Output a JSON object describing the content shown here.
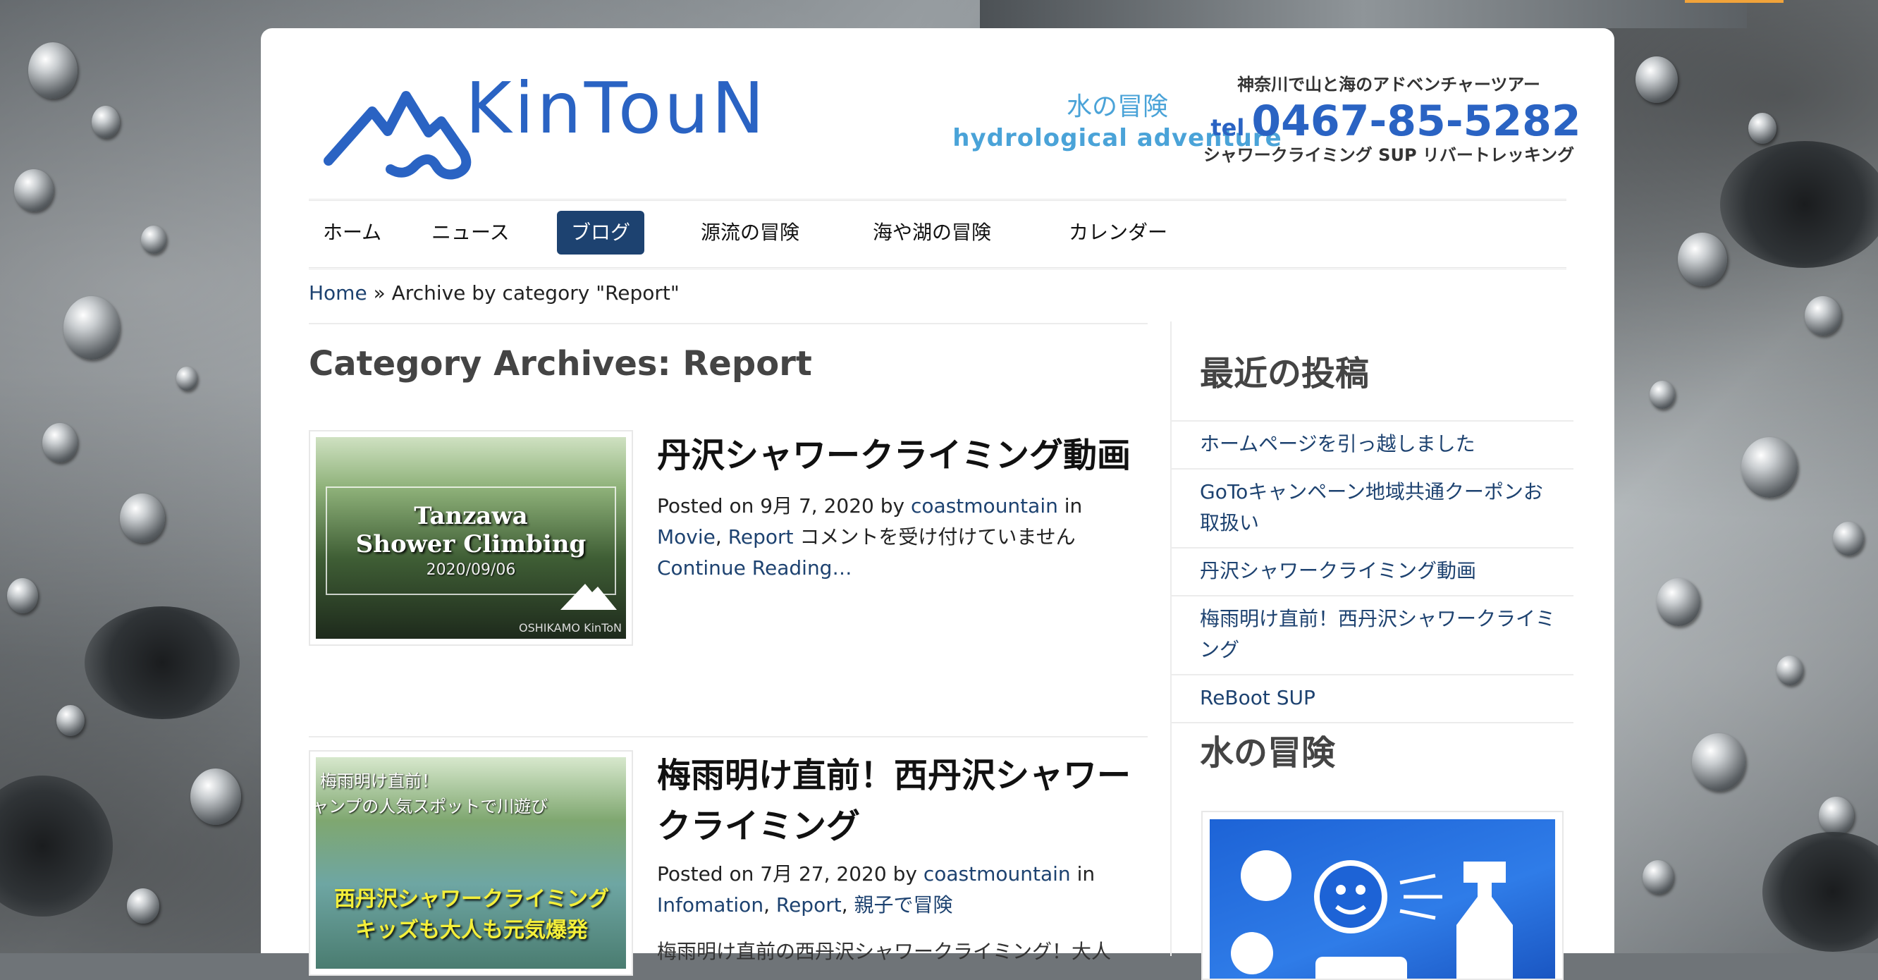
{
  "brand": {
    "logo_text": "KinTouN",
    "tagline_jp": "水の冒険",
    "tagline_en": "hydrological adventure",
    "contact_top": "神奈川で山と海のアドベンチャーツアー",
    "tel_label": "tel",
    "phone": "0467-85-5282",
    "contact_bottom": "シャワークライミング SUP リバートレッキング",
    "color_primary": "#2a63c3",
    "color_light": "#4aa3d8"
  },
  "nav": {
    "items": [
      {
        "label": "ホーム"
      },
      {
        "label": "ニュース"
      },
      {
        "label": "ブログ",
        "active": true
      },
      {
        "label": "源流の冒険"
      },
      {
        "label": "海や湖の冒険"
      },
      {
        "label": "カレンダー"
      }
    ],
    "active_color": "#1d4270"
  },
  "breadcrumb": {
    "home": "Home",
    "separator": "»",
    "current": "Archive by category \"Report\""
  },
  "archive_title": "Category Archives: Report",
  "posts": [
    {
      "title": "丹沢シャワークライミング動画",
      "posted_on": "Posted on",
      "date": "9月 7, 2020",
      "by": "by",
      "author": "coastmountain",
      "in": "in",
      "categories": [
        "Movie",
        "Report"
      ],
      "comments": "コメントを受け付けていません",
      "continue": "Continue Reading…",
      "thumb_title_1": "Tanzawa",
      "thumb_title_2": "Shower Climbing",
      "thumb_date": "2020/09/06",
      "thumb_credit": "OSHIKAMO KinToN"
    },
    {
      "title": "梅雨明け直前！西丹沢シャワークライミング",
      "posted_on": "Posted on",
      "date": "7月 27, 2020",
      "by": "by",
      "author": "coastmountain",
      "in": "in",
      "categories": [
        "Infomation",
        "Report",
        "親子で冒険"
      ],
      "excerpt": "梅雨明け直前の西丹沢シャワークライミング！大人",
      "thumb_line_1": "梅雨明け直前！",
      "thumb_line_2": "キャンプの人気スポットで川遊び",
      "thumb_line_3": "西丹沢シャワークライミング",
      "thumb_line_4": "キッズも大人も元気爆発"
    }
  ],
  "sidebar": {
    "recent_title": "最近の投稿",
    "recent_posts": [
      "ホームページを引っ越しました",
      "GoToキャンペーン地域共通クーポンお取扱い",
      "丹沢シャワークライミング動画",
      "梅雨明け直前！西丹沢シャワークライミング",
      "ReBoot SUP"
    ],
    "water_title": "水の冒険"
  }
}
